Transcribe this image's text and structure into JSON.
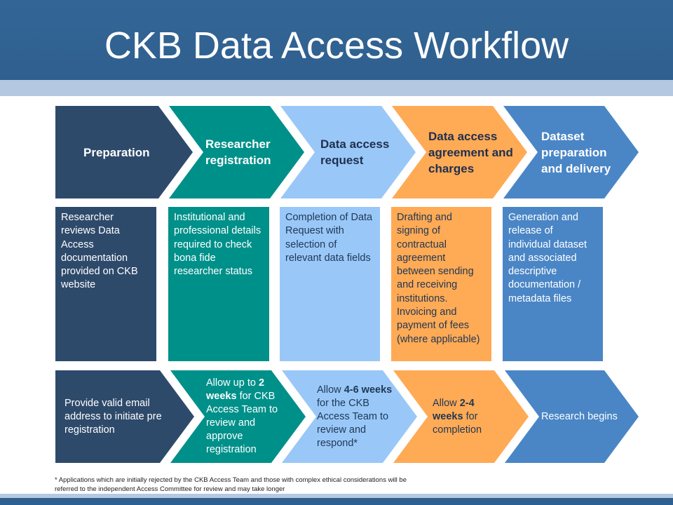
{
  "title": "CKB Data Access Workflow",
  "colors": {
    "header": "#336697",
    "band": "#b4c8e1",
    "stage_1": "#2e4a6b",
    "stage_2": "#00908a",
    "stage_3": "#99c8f8",
    "stage_4": "#ffaa55",
    "stage_5": "#4a86c6"
  },
  "stages": [
    {
      "name": "Preparation",
      "description": "Researcher reviews Data Access documentation provided on CKB website",
      "timeline": {
        "pre": "Provide valid email address to initiate pre registration",
        "bold": "",
        "post": ""
      }
    },
    {
      "name": "Researcher registration",
      "description": "Institutional  and professional details required to check bona fide researcher status",
      "timeline": {
        "pre": "Allow up to ",
        "bold": "2 weeks",
        "post": " for CKB Access Team to review and approve registration"
      }
    },
    {
      "name": "Data access request",
      "description": "Completion of Data Request with selection of relevant data fields",
      "timeline": {
        "pre": "Allow ",
        "bold": "4-6 weeks",
        "post": " for the CKB Access Team to review and respond*"
      }
    },
    {
      "name": "Data access agreement and charges",
      "description": "Drafting and signing of contractual agreement between sending and receiving institutions. Invoicing and payment of fees (where applicable)",
      "timeline": {
        "pre": "Allow ",
        "bold": "2-4 weeks",
        "post": " for completion"
      }
    },
    {
      "name": "Dataset preparation and delivery",
      "description": "Generation and release of individual dataset and associated descriptive documentation / metadata files",
      "timeline": {
        "pre": "Research begins",
        "bold": "",
        "post": ""
      }
    }
  ],
  "footnote": "* Applications which are initially rejected by the CKB Access Team and those with complex ethical considerations will be referred to the independent Access Committee for review and may take longer"
}
